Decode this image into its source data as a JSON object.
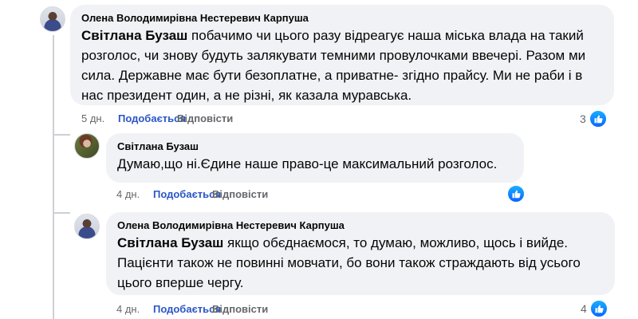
{
  "comments": [
    {
      "author": "Олена Володимирівна Нестеревич Карпуша",
      "mention": "Світлана Бузаш",
      "text": " побачимо чи цього разу відреагує наша міська влада на такий розголос, чи знову будуть залякувати темними провулочками ввечері. Разом ми сила. Державне має бути безоплатне, а приватне- згідно прайсу. Ми не раби і в нас президент один, а не різні, як казала муравська.",
      "time": "5 дн.",
      "like_label": "Подобається",
      "reply_label": "Відповісти",
      "reaction_count": "3"
    },
    {
      "author": "Світлана Бузаш",
      "text": "Думаю,що ні.Єдине наше право-це максимальний розголос.",
      "time": "4 дн.",
      "like_label": "Подобається",
      "reply_label": "Відповісти",
      "reaction_count": ""
    },
    {
      "author": "Олена Володимирівна Нестеревич Карпуша",
      "mention": "Світлана Бузаш",
      "text": " якщо обєднаємося, то думаю, можливо, щось і вийде. Пацієнти також не повинні мовчати, бо вони також страждають від усього цього вперше чергу.",
      "time": "4 дн.",
      "like_label": "Подобається",
      "reply_label": "Відповісти",
      "reaction_count": "4"
    }
  ],
  "colors": {
    "bubble": "#f0f2f5",
    "like_link": "#2a56c6",
    "meta": "#65676b",
    "like_badge": "#0866ff"
  },
  "icons": {
    "reaction": "thumbs-up-icon"
  }
}
